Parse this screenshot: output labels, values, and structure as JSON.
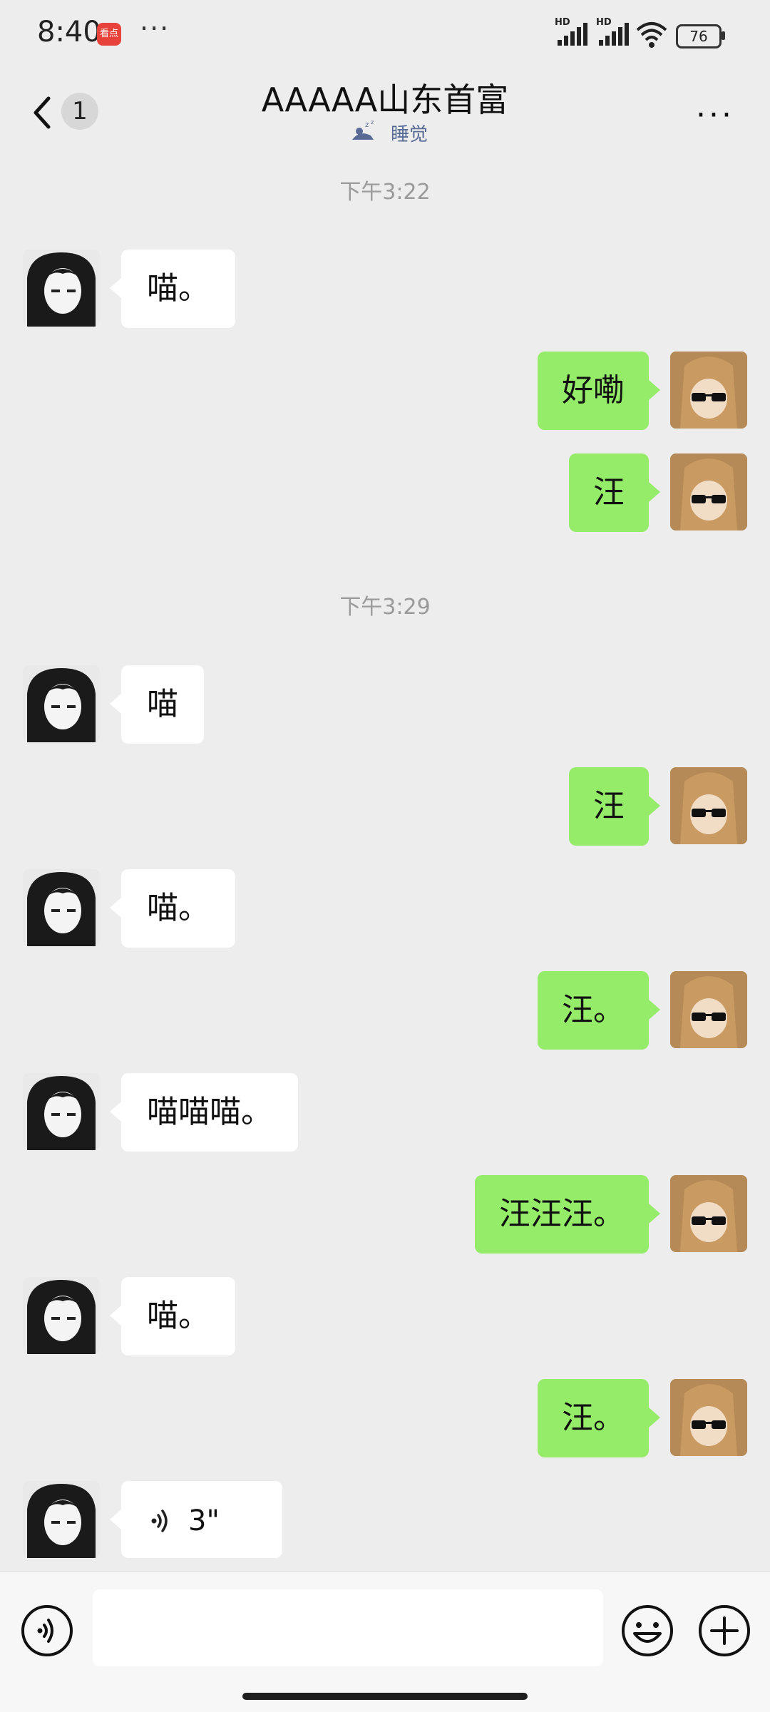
{
  "status_bar": {
    "time": "8:40",
    "app_badge": "看点",
    "dots": "···",
    "signal1_label": "HD",
    "signal2_label": "HD",
    "battery": "76"
  },
  "header": {
    "unread_count": "1",
    "title": "AAAAA山东首富",
    "status_text": "睡觉",
    "more": "···"
  },
  "messages": [
    {
      "type": "time",
      "text": "下午3:22"
    },
    {
      "type": "text",
      "side": "left",
      "text": "喵。"
    },
    {
      "type": "text",
      "side": "right",
      "text": "好嘞"
    },
    {
      "type": "text",
      "side": "right",
      "text": "汪"
    },
    {
      "type": "time",
      "text": "下午3:29"
    },
    {
      "type": "text",
      "side": "left",
      "text": "喵"
    },
    {
      "type": "text",
      "side": "right",
      "text": "汪"
    },
    {
      "type": "text",
      "side": "left",
      "text": "喵。"
    },
    {
      "type": "text",
      "side": "right",
      "text": "汪。"
    },
    {
      "type": "text",
      "side": "left",
      "text": "喵喵喵。"
    },
    {
      "type": "text",
      "side": "right",
      "text": "汪汪汪。"
    },
    {
      "type": "text",
      "side": "left",
      "text": "喵。"
    },
    {
      "type": "text",
      "side": "right",
      "text": "汪。"
    },
    {
      "type": "voice",
      "side": "left",
      "duration": "3\""
    }
  ],
  "input": {
    "value": "",
    "icons": [
      "voice-icon",
      "emoji-icon",
      "plus-icon"
    ]
  },
  "colors": {
    "background": "#ededed",
    "bubble_out": "#95ec69",
    "bubble_in": "#ffffff",
    "status_text": "#576b95"
  }
}
